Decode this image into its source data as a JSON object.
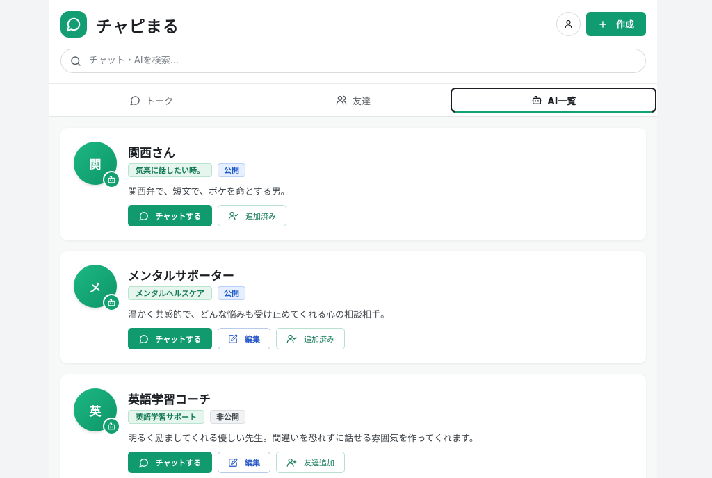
{
  "header": {
    "app_title": "チャピまる",
    "create_label": "作成"
  },
  "search": {
    "placeholder": "チャット・AIを検索..."
  },
  "tabs": [
    {
      "label": "トーク",
      "icon": "chat-bubble-icon"
    },
    {
      "label": "友達",
      "icon": "users-icon"
    },
    {
      "label": "AI一覧",
      "icon": "bot-icon",
      "active": true
    }
  ],
  "cards": [
    {
      "avatar_char": "関",
      "name": "関西さん",
      "category": "気楽に話したい時。",
      "visibility": "公開",
      "description": "関西弁で、短文で、ボケを命とする男。",
      "chat_label": "チャットする",
      "friend_label": "追加済み",
      "friend_status": "added"
    },
    {
      "avatar_char": "メ",
      "name": "メンタルサポーター",
      "category": "メンタルヘルスケア",
      "visibility": "公開",
      "description": "温かく共感的で、どんな悩みも受け止めてくれる心の相談相手。",
      "chat_label": "チャットする",
      "edit_label": "編集",
      "friend_label": "追加済み",
      "friend_status": "added"
    },
    {
      "avatar_char": "英",
      "name": "英語学習コーチ",
      "category": "英語学習サポート",
      "visibility": "非公開",
      "description": "明るく励ましてくれる優しい先生。間違いを恐れずに話せる雰囲気を作ってくれます。",
      "chat_label": "チャットする",
      "edit_label": "編集",
      "friend_label": "友達追加",
      "friend_status": "add"
    }
  ],
  "colors": {
    "brand": "#119b70",
    "public_tag": "#1e58c8",
    "edit": "#2456c8"
  }
}
